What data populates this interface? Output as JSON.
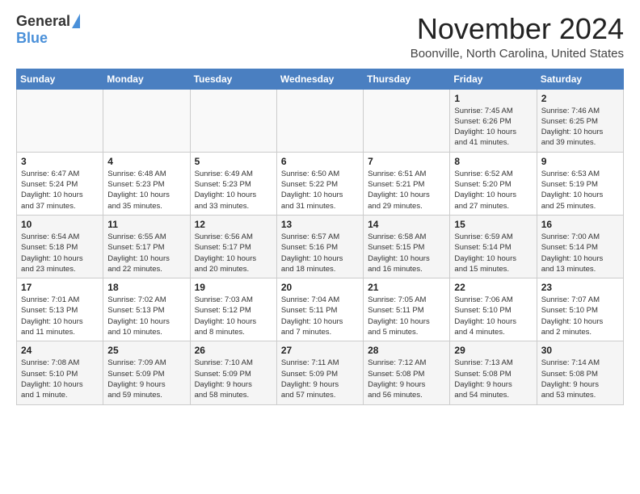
{
  "header": {
    "logo_general": "General",
    "logo_blue": "Blue",
    "month_title": "November 2024",
    "location": "Boonville, North Carolina, United States"
  },
  "weekdays": [
    "Sunday",
    "Monday",
    "Tuesday",
    "Wednesday",
    "Thursday",
    "Friday",
    "Saturday"
  ],
  "weeks": [
    [
      {
        "day": "",
        "info": ""
      },
      {
        "day": "",
        "info": ""
      },
      {
        "day": "",
        "info": ""
      },
      {
        "day": "",
        "info": ""
      },
      {
        "day": "",
        "info": ""
      },
      {
        "day": "1",
        "info": "Sunrise: 7:45 AM\nSunset: 6:26 PM\nDaylight: 10 hours\nand 41 minutes."
      },
      {
        "day": "2",
        "info": "Sunrise: 7:46 AM\nSunset: 6:25 PM\nDaylight: 10 hours\nand 39 minutes."
      }
    ],
    [
      {
        "day": "3",
        "info": "Sunrise: 6:47 AM\nSunset: 5:24 PM\nDaylight: 10 hours\nand 37 minutes."
      },
      {
        "day": "4",
        "info": "Sunrise: 6:48 AM\nSunset: 5:23 PM\nDaylight: 10 hours\nand 35 minutes."
      },
      {
        "day": "5",
        "info": "Sunrise: 6:49 AM\nSunset: 5:23 PM\nDaylight: 10 hours\nand 33 minutes."
      },
      {
        "day": "6",
        "info": "Sunrise: 6:50 AM\nSunset: 5:22 PM\nDaylight: 10 hours\nand 31 minutes."
      },
      {
        "day": "7",
        "info": "Sunrise: 6:51 AM\nSunset: 5:21 PM\nDaylight: 10 hours\nand 29 minutes."
      },
      {
        "day": "8",
        "info": "Sunrise: 6:52 AM\nSunset: 5:20 PM\nDaylight: 10 hours\nand 27 minutes."
      },
      {
        "day": "9",
        "info": "Sunrise: 6:53 AM\nSunset: 5:19 PM\nDaylight: 10 hours\nand 25 minutes."
      }
    ],
    [
      {
        "day": "10",
        "info": "Sunrise: 6:54 AM\nSunset: 5:18 PM\nDaylight: 10 hours\nand 23 minutes."
      },
      {
        "day": "11",
        "info": "Sunrise: 6:55 AM\nSunset: 5:17 PM\nDaylight: 10 hours\nand 22 minutes."
      },
      {
        "day": "12",
        "info": "Sunrise: 6:56 AM\nSunset: 5:17 PM\nDaylight: 10 hours\nand 20 minutes."
      },
      {
        "day": "13",
        "info": "Sunrise: 6:57 AM\nSunset: 5:16 PM\nDaylight: 10 hours\nand 18 minutes."
      },
      {
        "day": "14",
        "info": "Sunrise: 6:58 AM\nSunset: 5:15 PM\nDaylight: 10 hours\nand 16 minutes."
      },
      {
        "day": "15",
        "info": "Sunrise: 6:59 AM\nSunset: 5:14 PM\nDaylight: 10 hours\nand 15 minutes."
      },
      {
        "day": "16",
        "info": "Sunrise: 7:00 AM\nSunset: 5:14 PM\nDaylight: 10 hours\nand 13 minutes."
      }
    ],
    [
      {
        "day": "17",
        "info": "Sunrise: 7:01 AM\nSunset: 5:13 PM\nDaylight: 10 hours\nand 11 minutes."
      },
      {
        "day": "18",
        "info": "Sunrise: 7:02 AM\nSunset: 5:13 PM\nDaylight: 10 hours\nand 10 minutes."
      },
      {
        "day": "19",
        "info": "Sunrise: 7:03 AM\nSunset: 5:12 PM\nDaylight: 10 hours\nand 8 minutes."
      },
      {
        "day": "20",
        "info": "Sunrise: 7:04 AM\nSunset: 5:11 PM\nDaylight: 10 hours\nand 7 minutes."
      },
      {
        "day": "21",
        "info": "Sunrise: 7:05 AM\nSunset: 5:11 PM\nDaylight: 10 hours\nand 5 minutes."
      },
      {
        "day": "22",
        "info": "Sunrise: 7:06 AM\nSunset: 5:10 PM\nDaylight: 10 hours\nand 4 minutes."
      },
      {
        "day": "23",
        "info": "Sunrise: 7:07 AM\nSunset: 5:10 PM\nDaylight: 10 hours\nand 2 minutes."
      }
    ],
    [
      {
        "day": "24",
        "info": "Sunrise: 7:08 AM\nSunset: 5:10 PM\nDaylight: 10 hours\nand 1 minute."
      },
      {
        "day": "25",
        "info": "Sunrise: 7:09 AM\nSunset: 5:09 PM\nDaylight: 9 hours\nand 59 minutes."
      },
      {
        "day": "26",
        "info": "Sunrise: 7:10 AM\nSunset: 5:09 PM\nDaylight: 9 hours\nand 58 minutes."
      },
      {
        "day": "27",
        "info": "Sunrise: 7:11 AM\nSunset: 5:09 PM\nDaylight: 9 hours\nand 57 minutes."
      },
      {
        "day": "28",
        "info": "Sunrise: 7:12 AM\nSunset: 5:08 PM\nDaylight: 9 hours\nand 56 minutes."
      },
      {
        "day": "29",
        "info": "Sunrise: 7:13 AM\nSunset: 5:08 PM\nDaylight: 9 hours\nand 54 minutes."
      },
      {
        "day": "30",
        "info": "Sunrise: 7:14 AM\nSunset: 5:08 PM\nDaylight: 9 hours\nand 53 minutes."
      }
    ]
  ]
}
